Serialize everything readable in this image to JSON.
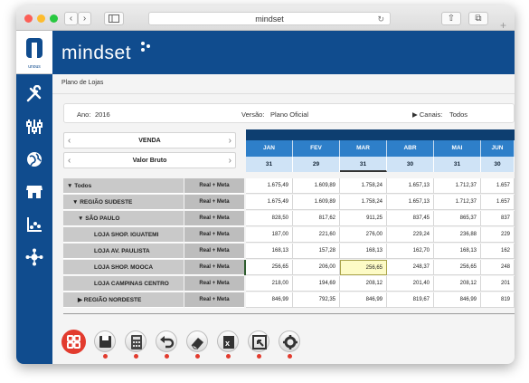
{
  "browser": {
    "url": "mindset"
  },
  "brand": {
    "logo_text": "mindset",
    "company_text": "unous"
  },
  "breadcrumb": "Plano de Lojas",
  "filters": {
    "ano_label": "Ano:",
    "ano_value": "2016",
    "versao_label": "Versão:",
    "versao_value": "Plano Oficial",
    "canais_label": "▶ Canais:",
    "canais_value": "Todos"
  },
  "selectors": {
    "measure": "VENDA",
    "value_type": "Valor Bruto"
  },
  "months": [
    {
      "name": "JAN",
      "days": "31"
    },
    {
      "name": "FEV",
      "days": "29"
    },
    {
      "name": "MAR",
      "days": "31"
    },
    {
      "name": "ABR",
      "days": "30"
    },
    {
      "name": "MAI",
      "days": "31"
    },
    {
      "name": "JUN",
      "days": "30"
    }
  ],
  "rows": [
    {
      "label": "▼ Todos",
      "type": "Real + Meta",
      "values": [
        "1.675,49",
        "1.609,89",
        "1.758,24",
        "1.657,13",
        "1.712,37",
        "1.657"
      ]
    },
    {
      "label": "▼ REGIÃO SUDESTE",
      "type": "Real + Meta",
      "values": [
        "1.675,49",
        "1.609,89",
        "1.758,24",
        "1.657,13",
        "1.712,37",
        "1.657"
      ]
    },
    {
      "label": "▼ SÃO PAULO",
      "type": "Real + Meta",
      "values": [
        "828,50",
        "817,62",
        "911,25",
        "837,45",
        "865,37",
        "837"
      ]
    },
    {
      "label": "LOJA SHOP. IGUATEMI",
      "type": "Real + Meta",
      "values": [
        "187,00",
        "221,60",
        "276,00",
        "229,24",
        "236,88",
        "229"
      ]
    },
    {
      "label": "LOJA AV. PAULISTA",
      "type": "Real + Meta",
      "values": [
        "168,13",
        "157,28",
        "168,13",
        "162,70",
        "168,13",
        "162"
      ]
    },
    {
      "label": "LOJA SHOP. MOOCA",
      "type": "Real + Meta",
      "values": [
        "256,65",
        "206,00",
        "256,65",
        "248,37",
        "256,65",
        "248"
      ]
    },
    {
      "label": "LOJA CAMPINAS CENTRO",
      "type": "Real + Meta",
      "values": [
        "218,00",
        "194,69",
        "208,12",
        "201,40",
        "208,12",
        "201"
      ]
    },
    {
      "label": "▶ REGIÃO NORDESTE",
      "type": "Real + Meta",
      "values": [
        "846,99",
        "792,35",
        "846,99",
        "819,67",
        "846,99",
        "819"
      ]
    }
  ],
  "sidebar_icons": [
    "tools-icon",
    "sliders-icon",
    "globe-icon",
    "store-icon",
    "chart-icon",
    "network-icon"
  ],
  "toolbar_icons": [
    "save-icon",
    "calculator-icon",
    "undo-icon",
    "eraser-icon",
    "excel-icon",
    "export-icon",
    "settings-icon"
  ],
  "colors": {
    "primary": "#104c8e",
    "month_header": "#2e7fc9",
    "accent": "#e23b2e"
  }
}
